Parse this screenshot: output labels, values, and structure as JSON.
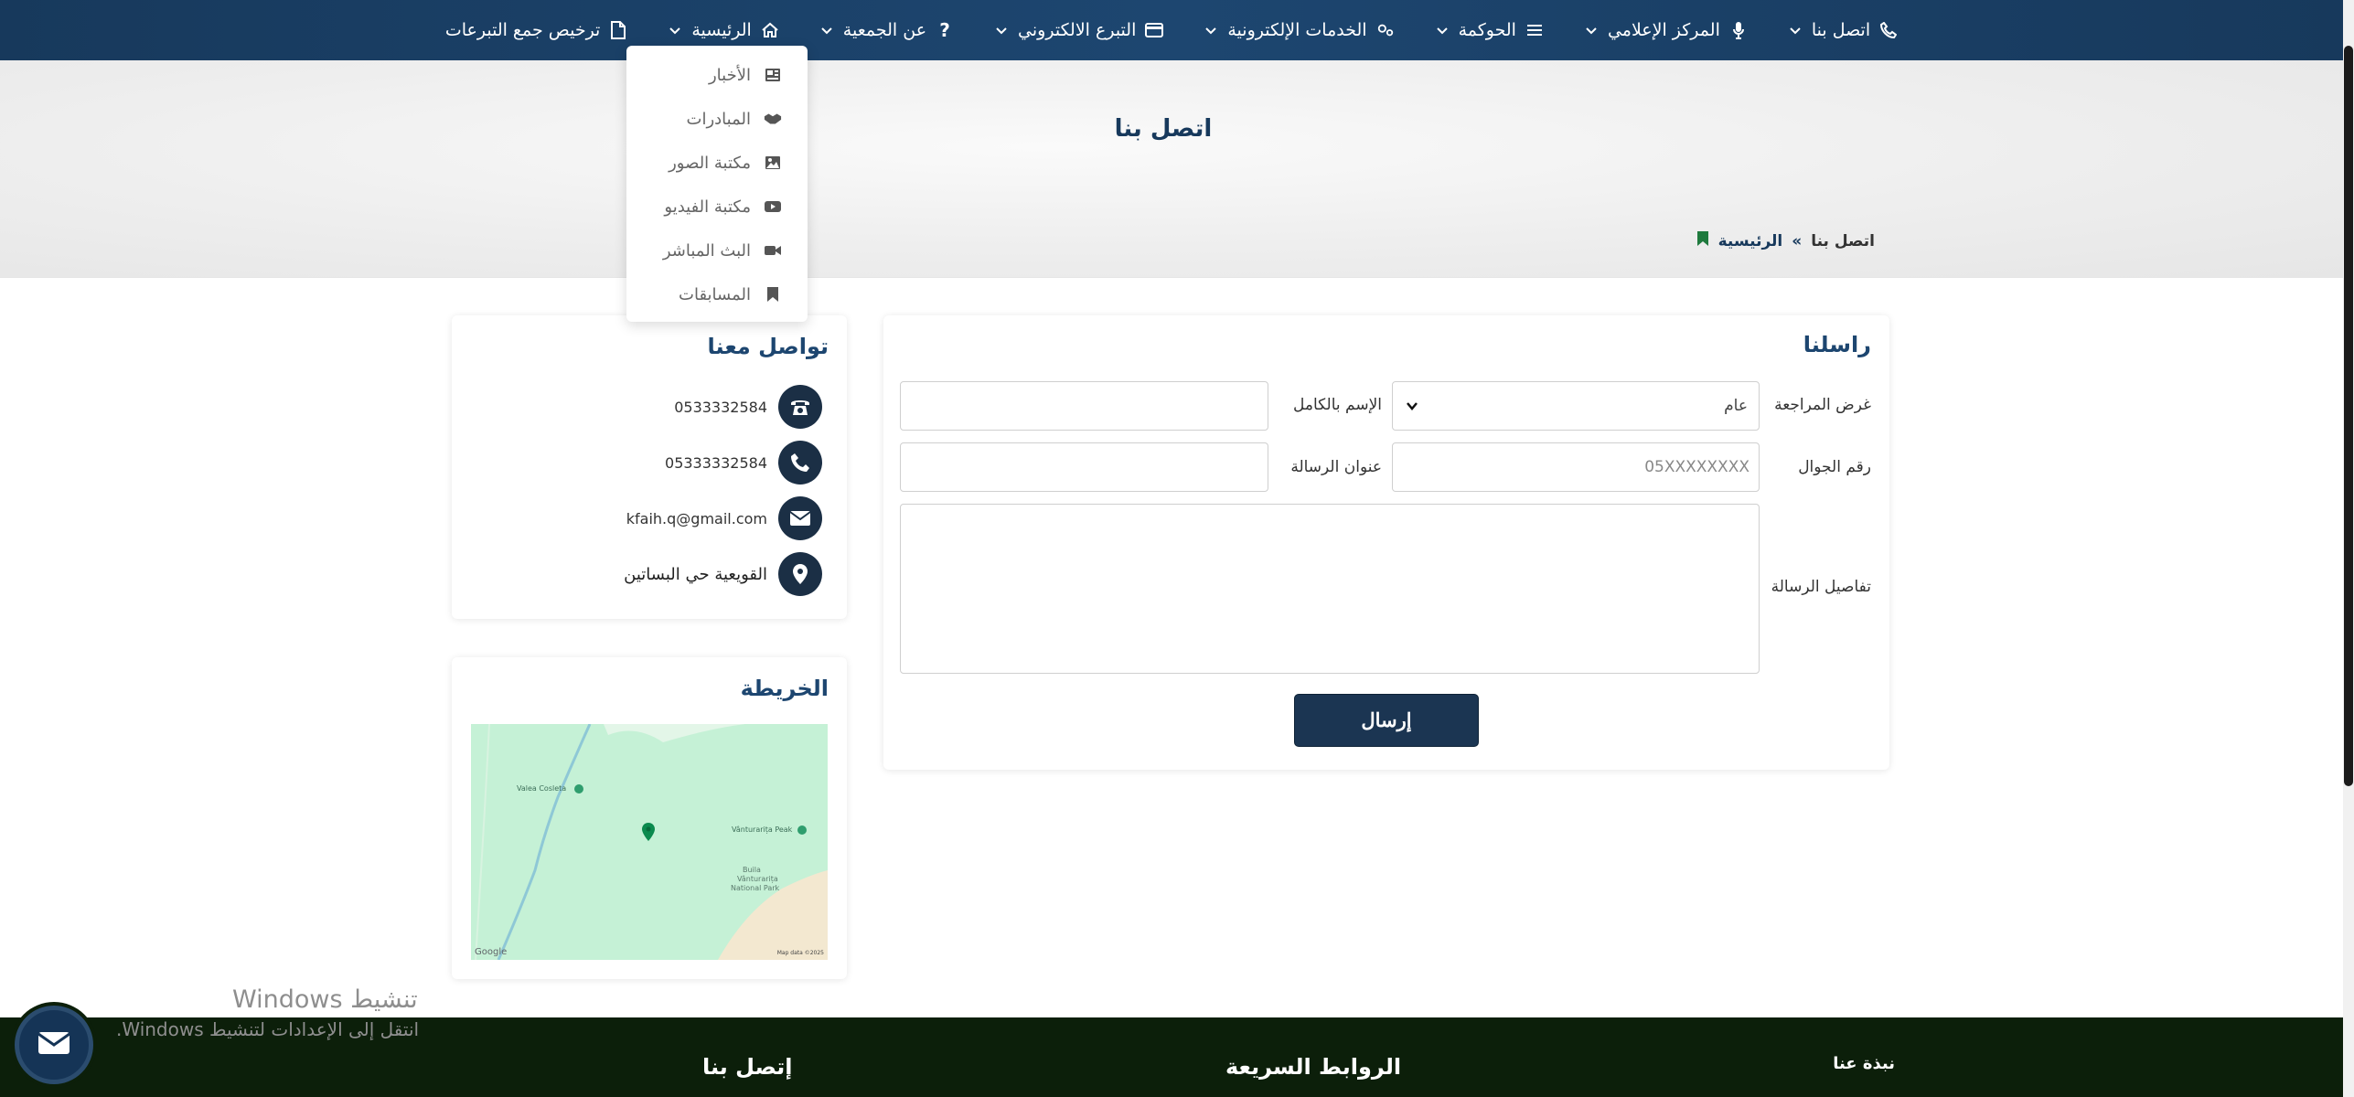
{
  "nav": {
    "items": [
      {
        "label": "ترخيص جمع التبرعات",
        "icon": "file-icon",
        "has_chevron": false
      },
      {
        "label": "الرئيسية",
        "icon": "home-icon",
        "has_chevron": true
      },
      {
        "label": "عن الجمعية",
        "icon": "question-icon",
        "has_chevron": true
      },
      {
        "label": "التبرع الالكتروني",
        "icon": "credit-card-icon",
        "has_chevron": true
      },
      {
        "label": "الخدمات الإلكترونية",
        "icon": "cogs-icon",
        "has_chevron": true
      },
      {
        "label": "الحوكمة",
        "icon": "list-icon",
        "has_chevron": true
      },
      {
        "label": "المركز الإعلامي",
        "icon": "microphone-icon",
        "has_chevron": true
      },
      {
        "label": "اتصل بنا",
        "icon": "phone-icon",
        "has_chevron": true
      }
    ]
  },
  "media_dropdown": {
    "items": [
      {
        "label": "الأخبار",
        "icon": "newspaper-icon"
      },
      {
        "label": "المبادرات",
        "icon": "handshake-icon"
      },
      {
        "label": "مكتبة الصور",
        "icon": "image-icon"
      },
      {
        "label": "مكتبة الفيديو",
        "icon": "youtube-icon"
      },
      {
        "label": "البث المباشر",
        "icon": "video-camera-icon"
      },
      {
        "label": "المسابقات",
        "icon": "bookmark-icon"
      }
    ]
  },
  "hero": {
    "title": "اتصل بنا",
    "breadcrumb": {
      "home": "الرئيسية",
      "separator": "»",
      "current": "اتصل بنا"
    }
  },
  "form": {
    "title": "راسلنا",
    "purpose_label": "غرض المراجعة",
    "purpose_value": "عام",
    "fullname_label": "الإسم بالكامل",
    "fullname_value": "",
    "mobile_label": "رقم الجوال",
    "mobile_placeholder": "05XXXXXXXX",
    "subject_label": "عنوان الرسالة",
    "subject_value": "",
    "details_label": "تفاصيل الرسالة",
    "submit_label": "إرسال"
  },
  "contact": {
    "title": "تواصل معنا",
    "phone": "0533332584",
    "mobile": "05333332584",
    "email": "kfaih.q@gmail.com",
    "address": "القويعية حي البساتين"
  },
  "map": {
    "title": "الخريطة",
    "labels": {
      "place1": "Valea Cosleta",
      "place2": "Vânturarița Peak",
      "park_line1": "Buila",
      "park_line2": "Vânturarița",
      "park_line3": "National Park",
      "google": "Google",
      "credit": "Map data ©2025"
    }
  },
  "footer": {
    "about": "نبذة عنا",
    "quick_links": "الروابط السريعة",
    "contact": "إتصل بنا"
  },
  "watermark": {
    "line1": "تنشيط Windows",
    "line2": "انتقل إلى الإعدادات لتنشيط Windows."
  },
  "colors": {
    "navy": "#17395c",
    "button": "#1b3552",
    "footer": "#0c1f0a",
    "map_green": "#c5f1d6",
    "accent_green": "#1f7a3e"
  }
}
